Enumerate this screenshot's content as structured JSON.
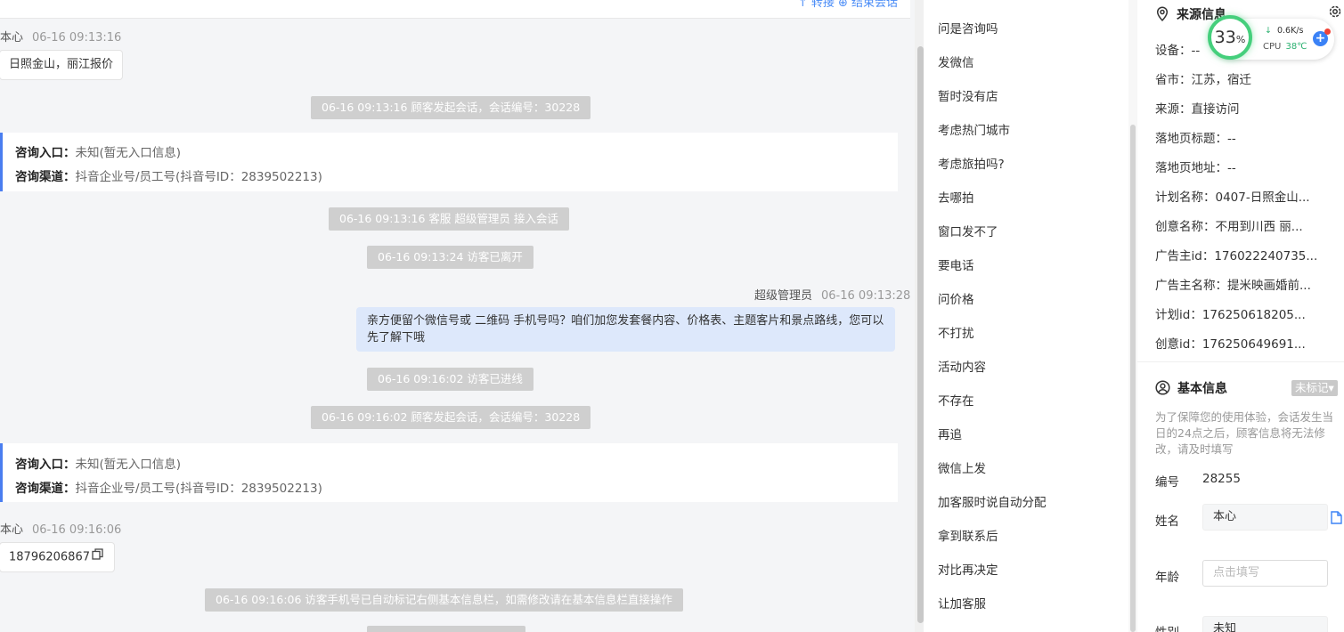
{
  "header": {
    "right_links": "↑ 转接  ⊕ 结束会话"
  },
  "messages": {
    "m1_name": "本心",
    "m1_time": "06-16 09:13:16",
    "m1_text": "日照金山，丽江报价",
    "sys1": "06-16 09:13:16 顾客发起会话，会话编号：30228",
    "card1_entry_label": "咨询入口：",
    "card1_entry_value": "未知(暂无入口信息)",
    "card1_channel_label": "咨询渠道：",
    "card1_channel_value": "抖音企业号/员工号(抖音号ID：2839502213)",
    "sys2": "06-16 09:13:16 客服 超级管理员 接入会话",
    "sys3": "06-16 09:13:24 访客已离开",
    "agent_name": "超级管理员",
    "agent_time": "06-16 09:13:28",
    "agent_text": "亲方便留个微信号或 二维码 手机号吗？咱们加您发套餐内容、价格表、主题客片和景点路线，您可以先了解下哦",
    "sys4": "06-16 09:16:02 访客已进线",
    "sys5": "06-16 09:16:02 顾客发起会话，会话编号：30228",
    "card2_entry_label": "咨询入口：",
    "card2_entry_value": "未知(暂无入口信息)",
    "card2_channel_label": "咨询渠道：",
    "card2_channel_value": "抖音企业号/员工号(抖音号ID：2839502213)",
    "m2_name": "本心",
    "m2_time": "06-16 09:16:06",
    "m2_text": "18796206867",
    "sys6": "06-16 09:16:06 访客手机号已自动标记右侧基本信息栏，如需修改请在基本信息栏直接操作"
  },
  "quick_replies": [
    "问是咨询吗",
    "发微信",
    "暂时没有店",
    "考虑热门城市",
    "考虑旅拍吗?",
    "去哪拍",
    "窗口发不了",
    "要电话",
    "问价格",
    "不打扰",
    "活动内容",
    "不存在",
    "再追",
    "微信上发",
    "加客服时说自动分配",
    "拿到联系后",
    "对比再决定",
    "让加客服"
  ],
  "source_info": {
    "title": "来源信息",
    "device": "设备：--",
    "province": "省市：江苏，宿迁",
    "source": "来源：直接访问",
    "landing_title": "落地页标题：--",
    "landing_url": "落地页地址：--",
    "plan_name": "计划名称：0407-日照金山...",
    "creative_name": "创意名称：不用到川西 丽...",
    "advertiser_id": "广告主id：176022240735...",
    "advertiser_name": "广告主名称：提米映画婚前...",
    "plan_id": "计划id：176250618205...",
    "creative_id": "创意id：176250649691..."
  },
  "basic_info": {
    "title": "基本信息",
    "tag": "未标记▾",
    "note": "为了保障您的使用体验，会话发生当日的24点之后，顾客信息将无法修改，请及时填写",
    "id_label": "编号",
    "id_value": "28255",
    "name_label": "姓名",
    "name_value": "本心",
    "age_label": "年龄",
    "age_placeholder": "点击填写",
    "gender_label": "性别",
    "gender_value": "未知"
  },
  "widget": {
    "percent": "33",
    "percent_unit": "%",
    "speed": "0.6K/s",
    "cpu_label": "CPU",
    "cpu_temp": "38℃"
  },
  "colors": {
    "accent": "#4a7ef0",
    "bubble_agent": "#dde8fb",
    "system_pill": "#cfcfcf",
    "ring": "#45cf7c"
  }
}
